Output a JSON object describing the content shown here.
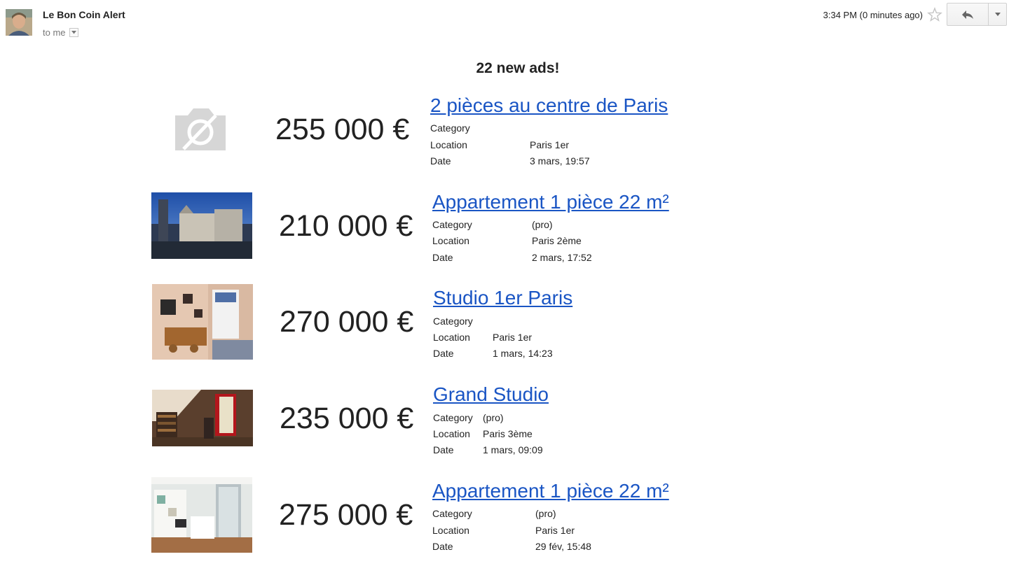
{
  "header": {
    "sender": "Le Bon Coin Alert",
    "recipient": "to me",
    "timestamp": "3:34 PM (0 minutes ago)"
  },
  "email": {
    "heading": "22 new ads!",
    "detail_labels": {
      "category": "Category",
      "location": "Location",
      "date": "Date"
    }
  },
  "ads": [
    {
      "price": "255 000 €",
      "title": "2 pièces au centre de Paris",
      "category": "",
      "location": "Paris 1er",
      "date": "3 mars, 19:57"
    },
    {
      "price": "210 000 €",
      "title": "Appartement 1 pièce 22 m²",
      "category": "(pro)",
      "location": "Paris 2ème",
      "date": "2 mars, 17:52"
    },
    {
      "price": "270 000 €",
      "title": "Studio 1er Paris",
      "category": "",
      "location": "Paris 1er",
      "date": "1 mars, 14:23"
    },
    {
      "price": "235 000 €",
      "title": "Grand Studio",
      "category": "(pro)",
      "location": "Paris 3ème",
      "date": "1 mars, 09:09"
    },
    {
      "price": "275 000 €",
      "title": "Appartement 1 pièce 22 m²",
      "category": "(pro)",
      "location": "Paris 1er",
      "date": "29 fév, 15:48"
    }
  ]
}
